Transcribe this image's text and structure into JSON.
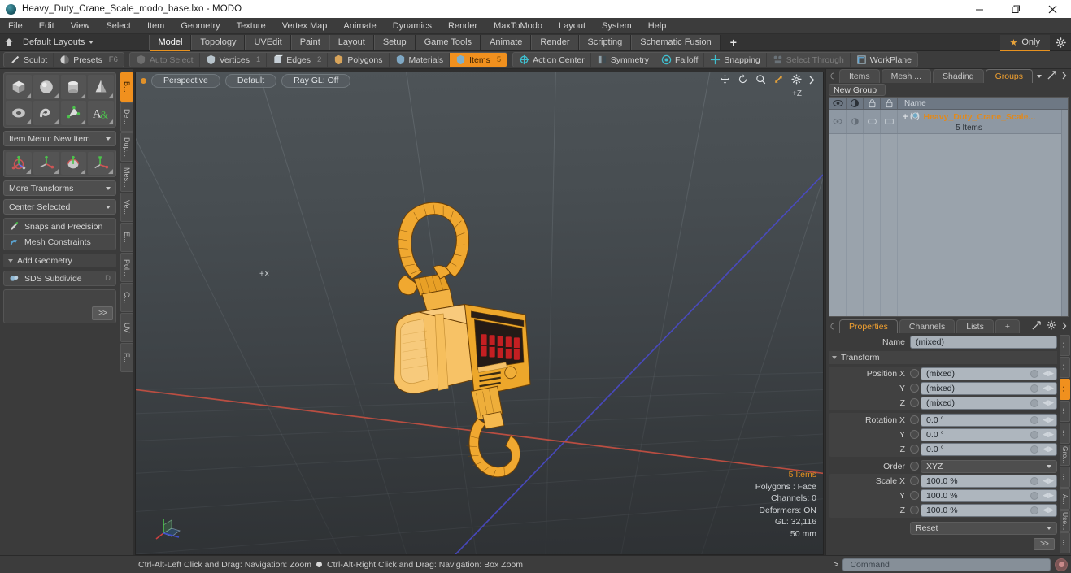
{
  "titlebar": {
    "title": "Heavy_Duty_Crane_Scale_modo_base.lxo - MODO",
    "minimize": "minimize-icon",
    "maximize": "restore-icon",
    "close": "close-icon"
  },
  "menubar": {
    "items": [
      {
        "label": "File"
      },
      {
        "label": "Edit"
      },
      {
        "label": "View"
      },
      {
        "label": "Select"
      },
      {
        "label": "Item"
      },
      {
        "label": "Geometry"
      },
      {
        "label": "Texture"
      },
      {
        "label": "Vertex Map"
      },
      {
        "label": "Animate"
      },
      {
        "label": "Dynamics"
      },
      {
        "label": "Render"
      },
      {
        "label": "MaxToModo"
      },
      {
        "label": "Layout"
      },
      {
        "label": "System"
      },
      {
        "label": "Help"
      }
    ]
  },
  "layoutrow": {
    "layouts_label": "Default Layouts",
    "tabs": [
      {
        "label": "Model",
        "active": true
      },
      {
        "label": "Topology",
        "active": false
      },
      {
        "label": "UVEdit",
        "active": false
      },
      {
        "label": "Paint",
        "active": false
      },
      {
        "label": "Layout",
        "active": false
      },
      {
        "label": "Setup",
        "active": false
      },
      {
        "label": "Game Tools",
        "active": false
      },
      {
        "label": "Animate",
        "active": false
      },
      {
        "label": "Render",
        "active": false
      },
      {
        "label": "Scripting",
        "active": false
      },
      {
        "label": "Schematic Fusion",
        "active": false
      }
    ],
    "add_label": "+",
    "only_label": "Only"
  },
  "seltoolbar": {
    "left_group": [
      {
        "label": "Sculpt",
        "num": "",
        "state": "normal"
      },
      {
        "label": "Presets",
        "num": "F6",
        "state": "normal"
      }
    ],
    "mode_group": [
      {
        "label": "Auto Select",
        "num": "",
        "state": "dim"
      },
      {
        "label": "Vertices",
        "num": "1",
        "state": "normal"
      },
      {
        "label": "Edges",
        "num": "2",
        "state": "normal"
      },
      {
        "label": "Polygons",
        "num": "",
        "state": "normal"
      },
      {
        "label": "Materials",
        "num": "",
        "state": "normal"
      },
      {
        "label": "Items",
        "num": "5",
        "state": "active"
      }
    ],
    "right_group": [
      {
        "label": "Action Center",
        "num": "",
        "state": "normal"
      },
      {
        "label": "Symmetry",
        "num": "",
        "state": "normal"
      },
      {
        "label": "Falloff",
        "num": "",
        "state": "normal"
      },
      {
        "label": "Snapping",
        "num": "",
        "state": "normal"
      },
      {
        "label": "Select Through",
        "num": "",
        "state": "dim"
      },
      {
        "label": "WorkPlane",
        "num": "",
        "state": "normal"
      }
    ]
  },
  "leftpanel": {
    "primitives": [
      "cube-icon",
      "sphere-icon",
      "cylinder-icon",
      "cone-icon",
      "torus-icon",
      "capsule-icon",
      "prism-icon",
      "text-icon"
    ],
    "item_menu": "Item Menu: New Item",
    "transforms": [
      "move-tool-icon",
      "rotate-tool-icon",
      "scale-tool-icon",
      "transform-tool-icon"
    ],
    "more_transforms": "More Transforms",
    "center_selected": "Center Selected",
    "snaps": "Snaps and Precision",
    "mesh_constraints": "Mesh Constraints",
    "add_geometry": "Add Geometry",
    "sds_subdivide": "SDS Subdivide",
    "sds_key": "D",
    "expand": ">>",
    "vtabs": [
      {
        "label": "B...",
        "active": true
      },
      {
        "label": "De...",
        "active": false
      },
      {
        "label": "Dup...",
        "active": false
      },
      {
        "label": "Mes...",
        "active": false
      },
      {
        "label": "Ve...",
        "active": false
      },
      {
        "label": "E...",
        "active": false
      },
      {
        "label": "Pol...",
        "active": false
      },
      {
        "label": "C...",
        "active": false
      },
      {
        "label": "UV",
        "active": false
      },
      {
        "label": "F...",
        "active": false
      }
    ]
  },
  "viewport": {
    "view_mode": "Perspective",
    "shading": "Default",
    "raygl": "Ray GL: Off",
    "icons": [
      "pan-icon",
      "rotate-icon",
      "zoom-icon",
      "fit-icon",
      "gear-icon",
      "chevron-right-icon"
    ],
    "axis_z": "+Z",
    "axis_x": "+X",
    "stats": {
      "items": "5 Items",
      "polygons": "Polygons : Face",
      "channels": "Channels: 0",
      "deformers": "Deformers: ON",
      "gl": "GL: 32,116",
      "unit": "50 mm"
    }
  },
  "rightpanel": {
    "top_tabs": [
      {
        "label": "Items",
        "active": false
      },
      {
        "label": "Mesh ...",
        "active": false
      },
      {
        "label": "Shading",
        "active": false
      },
      {
        "label": "Groups",
        "active": true
      }
    ],
    "new_group_label": "New Group",
    "tree": {
      "col_headers": [
        "visible-eye-icon",
        "render-icon",
        "lock-icon",
        "select-icon"
      ],
      "name_header": "Name",
      "rows": [
        {
          "name": "Heavy_Duty_Crane_Scale...",
          "subtitle": "5 Items"
        }
      ]
    },
    "props_tabs": [
      {
        "label": "Properties",
        "active": true
      },
      {
        "label": "Channels",
        "active": false
      },
      {
        "label": "Lists",
        "active": false
      },
      {
        "label": "+",
        "active": false
      }
    ],
    "properties": {
      "name_label": "Name",
      "name_value": "(mixed)",
      "transform_section": "Transform",
      "rows": [
        {
          "label": "Position X",
          "value": "(mixed)"
        },
        {
          "label": "Y",
          "value": "(mixed)"
        },
        {
          "label": "Z",
          "value": "(mixed)"
        },
        {
          "label": "Rotation X",
          "value": "0.0 °"
        },
        {
          "label": "Y",
          "value": "0.0 °"
        },
        {
          "label": "Z",
          "value": "0.0 °"
        }
      ],
      "order_label": "Order",
      "order_value": "XYZ",
      "scale_rows": [
        {
          "label": "Scale X",
          "value": "100.0 %"
        },
        {
          "label": "Y",
          "value": "100.0 %"
        },
        {
          "label": "Z",
          "value": "100.0 %"
        }
      ],
      "reset_label": "Reset",
      "expand": ">>"
    },
    "vtabs": [
      {
        "label": "...",
        "active": false
      },
      {
        "label": "...",
        "active": false
      },
      {
        "label": "...",
        "active": true
      },
      {
        "label": "...",
        "active": false
      },
      {
        "label": "...",
        "active": false
      },
      {
        "label": "Gro...",
        "active": false
      },
      {
        "label": "...",
        "active": false
      },
      {
        "label": "A...",
        "active": false
      },
      {
        "label": "Use...",
        "active": false
      },
      {
        "label": "...",
        "active": false
      }
    ]
  },
  "statusbar": {
    "hint_left": "Ctrl-Alt-Left Click and Drag: Navigation: Zoom",
    "hint_right": "Ctrl-Alt-Right Click and Drag: Navigation: Box Zoom",
    "command_prompt": ">",
    "command_placeholder": "Command"
  },
  "colors": {
    "accent": "#f0901e",
    "selection": "#e8921f",
    "panel_bg": "#3b3b3b",
    "viewport_top": "#4e5458",
    "viewport_bottom": "#2e3134",
    "field_bg": "#a8b0b8"
  }
}
